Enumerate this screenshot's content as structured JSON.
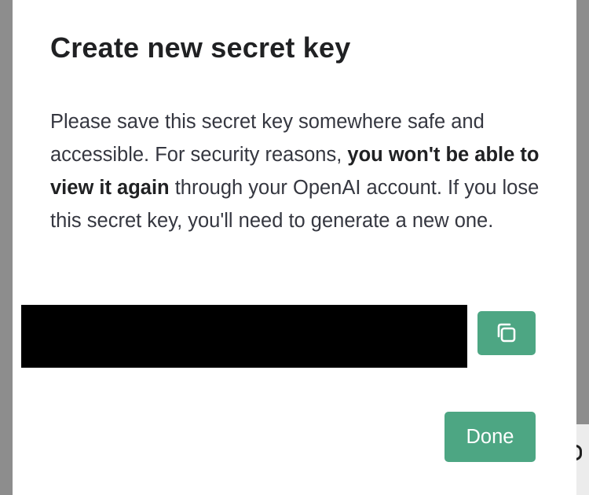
{
  "modal": {
    "title": "Create new secret key",
    "body": {
      "part1": "Please save this secret key somewhere safe and accessible. For security reasons, ",
      "bold": "you won't be able to view it again",
      "part2": " through your OpenAI account. If you lose this secret key, you'll need to generate a new one."
    },
    "key_field": {
      "value": "",
      "redacted": true
    },
    "copy_button": {
      "icon": "copy-icon"
    },
    "done_button": {
      "label": "Done"
    }
  },
  "colors": {
    "backdrop": "#8d8d8d",
    "modal_background": "#ffffff",
    "accent": "#4da683",
    "title_text": "#202123",
    "body_text": "#353740",
    "redaction": "#000000"
  }
}
